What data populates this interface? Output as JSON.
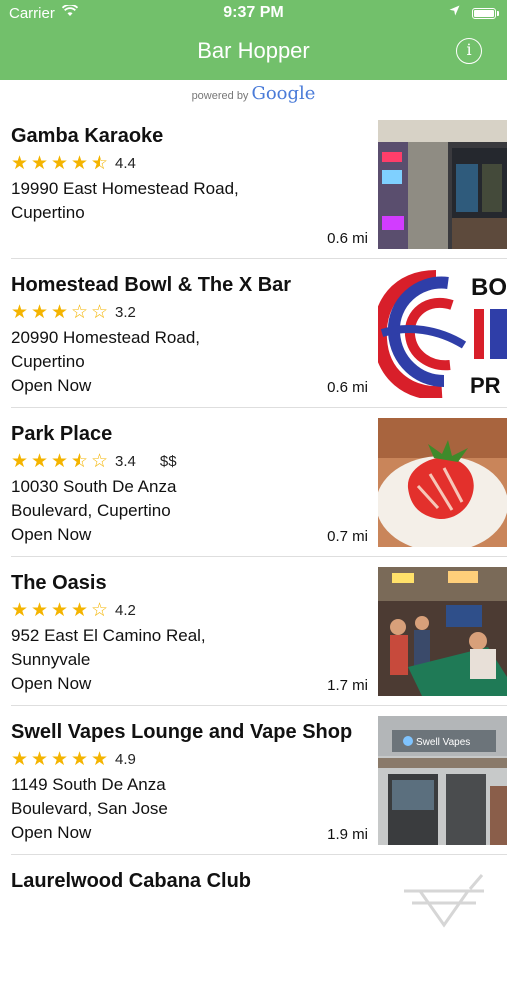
{
  "status": {
    "carrier": "Carrier",
    "time": "9:37 PM"
  },
  "header": {
    "title": "Bar Hopper",
    "info_icon": "i"
  },
  "attribution": {
    "prefix": "powered by",
    "brand": "Google"
  },
  "colors": {
    "header": "#72c06b",
    "star": "#f4b400"
  },
  "bars": [
    {
      "name": "Gamba Karaoke",
      "stars": [
        1,
        1,
        1,
        1,
        0.5
      ],
      "rating": "4.4",
      "price": "",
      "address": "19990 East Homestead Road, Cupertino",
      "open": "",
      "distance": "0.6 mi"
    },
    {
      "name": "Homestead Bowl & The X Bar",
      "stars": [
        1,
        1,
        1,
        0,
        0
      ],
      "rating": "3.2",
      "price": "",
      "address": "20990 Homestead Road, Cupertino",
      "open": "Open Now",
      "distance": "0.6 mi"
    },
    {
      "name": "Park Place",
      "stars": [
        1,
        1,
        1,
        0.5,
        0
      ],
      "rating": "3.4",
      "price": "$$",
      "address": "10030 South De Anza Boulevard, Cupertino",
      "open": "Open Now",
      "distance": "0.7 mi"
    },
    {
      "name": "The Oasis",
      "stars": [
        1,
        1,
        1,
        1,
        0
      ],
      "rating": "4.2",
      "price": "",
      "address": "952 East El Camino Real, Sunnyvale",
      "open": "Open Now",
      "distance": "1.7 mi"
    },
    {
      "name": "Swell Vapes Lounge and Vape Shop",
      "stars": [
        1,
        1,
        1,
        1,
        1
      ],
      "rating": "4.9",
      "price": "",
      "address": "1149 South De Anza Boulevard, San Jose",
      "open": "Open Now",
      "distance": "1.9 mi"
    },
    {
      "name": "Laurelwood Cabana Club",
      "stars": [],
      "rating": "",
      "price": "",
      "address": "",
      "open": "",
      "distance": ""
    }
  ]
}
